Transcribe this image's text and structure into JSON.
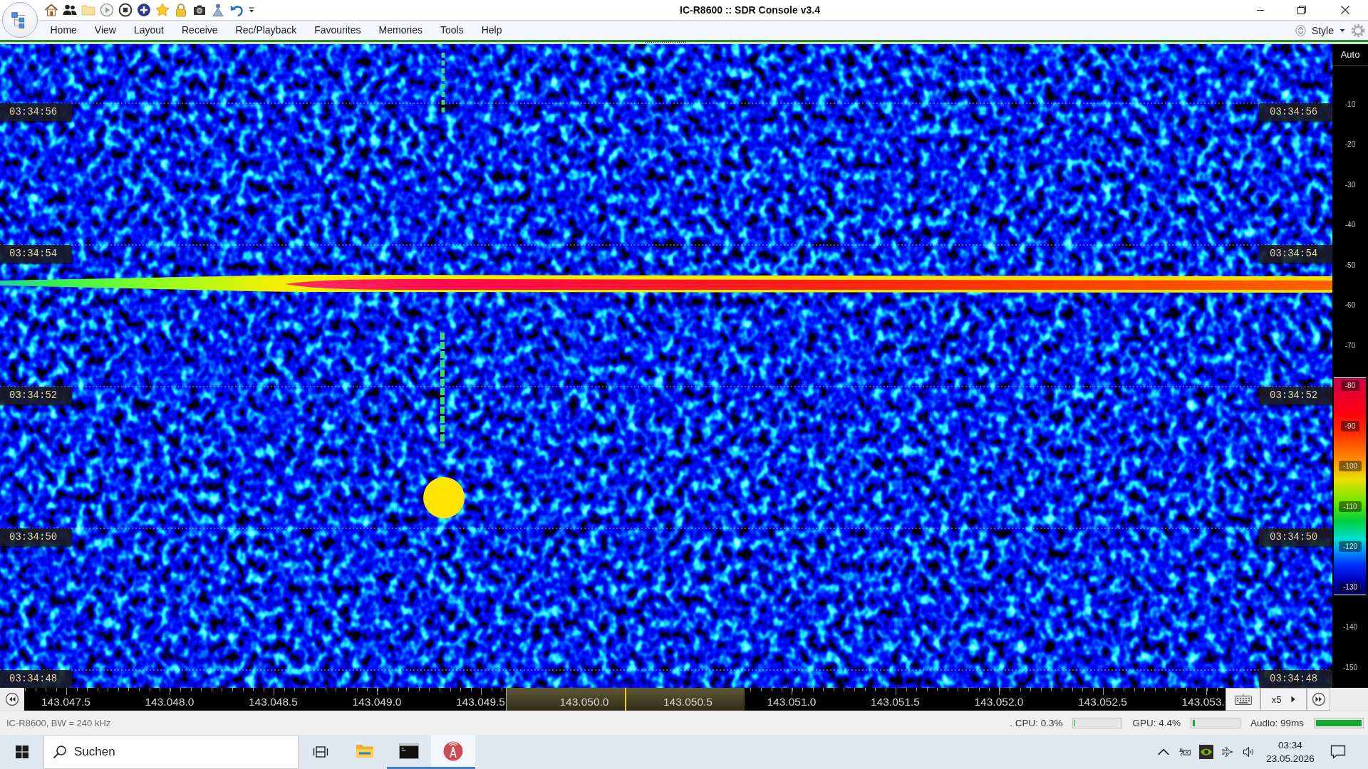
{
  "window": {
    "title": "IC-R8600 :: SDR Console v3.4"
  },
  "menu": {
    "items": [
      "Home",
      "View",
      "Layout",
      "Receive",
      "Rec/Playback",
      "Favourites",
      "Memories",
      "Tools",
      "Help"
    ],
    "style_button": "Style"
  },
  "waterfall": {
    "left_time_labels": [
      "03:34:56",
      "03:34:54",
      "03:34:52",
      "03:34:50",
      "03:34:48"
    ],
    "right_time_labels": [
      "03:34:56",
      "03:34:54",
      "03:34:52",
      "03:34:50",
      "03:34:48"
    ]
  },
  "level_scale": {
    "mode": "Auto",
    "labels": [
      {
        "text": "-10",
        "kind": "plain"
      },
      {
        "text": "-20",
        "kind": "plain"
      },
      {
        "text": "-30",
        "kind": "plain"
      },
      {
        "text": "-40",
        "kind": "plain"
      },
      {
        "text": "-50",
        "kind": "plain"
      },
      {
        "text": "-60",
        "kind": "plain"
      },
      {
        "text": "-70",
        "kind": "plain"
      },
      {
        "text": "-80",
        "kind": "palette"
      },
      {
        "text": "-90",
        "kind": "palette"
      },
      {
        "text": "-100",
        "kind": "palette"
      },
      {
        "text": "-110",
        "kind": "palette"
      },
      {
        "text": "-120",
        "kind": "palette"
      },
      {
        "text": "-130",
        "kind": "palette"
      },
      {
        "text": "-140",
        "kind": "plain"
      },
      {
        "text": "-150",
        "kind": "plain"
      }
    ]
  },
  "frequency_axis": {
    "labels": [
      "143.047.5",
      "143.048.0",
      "143.048.5",
      "143.049.0",
      "143.049.5",
      "143.050.0",
      "143.050.5",
      "143.051.0",
      "143.051.5",
      "143.052.0",
      "143.052.5",
      "143.053."
    ],
    "zoom": "x5"
  },
  "status_bar": {
    "device": "IC-R8600, BW = 240 kHz",
    "meters": [
      {
        "label": ". CPU: 0.3%",
        "level": 0.003
      },
      {
        "label": "GPU: 4.4%",
        "level": 0.044
      },
      {
        "label": "Audio: 99ms",
        "level": 1
      }
    ]
  },
  "taskbar": {
    "search": {
      "placeholder": "Suchen"
    },
    "apps": [
      {
        "kind": "explorer",
        "running": false,
        "selected": false
      },
      {
        "kind": "terminal",
        "running": true,
        "selected": false
      },
      {
        "kind": "sdr",
        "running": true,
        "selected": true
      }
    ],
    "clock": {
      "time": "03:34",
      "date": "23.05.2026"
    }
  }
}
